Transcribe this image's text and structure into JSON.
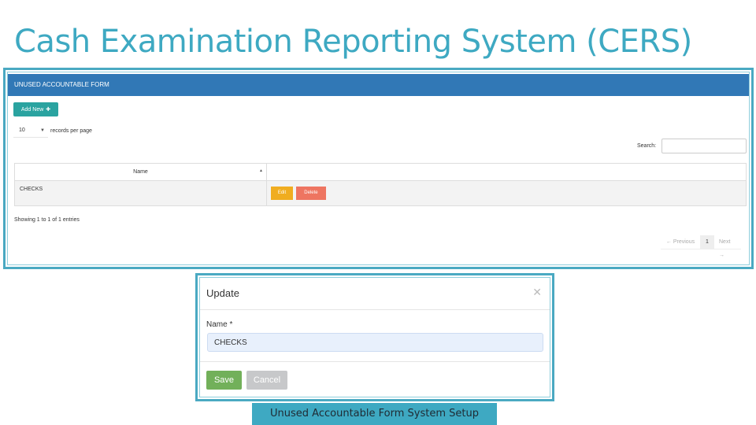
{
  "slide": {
    "title": "Cash Examination Reporting System (CERS)",
    "caption": "Unused Accountable Form System Setup"
  },
  "colors": {
    "accent": "#3ea9c2",
    "panel_header": "#3178b6",
    "add_button": "#2aa3a0",
    "edit_button": "#f0ad20",
    "delete_button": "#ee7561",
    "save_button": "#72b05a",
    "cancel_button": "#c7c8ca"
  },
  "list_view": {
    "header": "UNUSED ACCOUNTABLE FORM",
    "add_new_label": "Add New",
    "add_new_icon": "plus-icon",
    "page_size_value": "10",
    "records_per_page_label": "records per page",
    "search_label": "Search:",
    "search_value": "",
    "columns": [
      "Name",
      ""
    ],
    "rows": [
      {
        "name": "CHECKS",
        "edit_label": "Edit",
        "delete_label": "Delete"
      }
    ],
    "showing_text": "Showing 1 to 1 of 1 entries",
    "pagination": {
      "previous": "← Previous",
      "current": "1",
      "next": "Next →"
    }
  },
  "modal": {
    "title": "Update",
    "close_icon": "close-icon",
    "name_label": "Name *",
    "name_value": "CHECKS",
    "save_label": "Save",
    "cancel_label": "Cancel"
  }
}
